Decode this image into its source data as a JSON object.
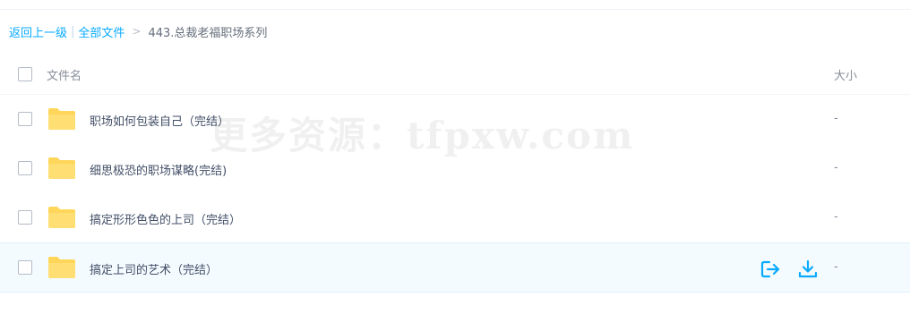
{
  "breadcrumb": {
    "back_label": "返回上一级",
    "separator": "|",
    "all_files_label": "全部文件",
    "arrow": ">",
    "current_folder": "443.总裁老福职场系列"
  },
  "table": {
    "columns": {
      "name": "文件名",
      "size": "大小"
    }
  },
  "files": [
    {
      "name": "职场如何包装自己（完结）",
      "size": "-",
      "type": "folder"
    },
    {
      "name": "细思极恐的职场谋略(完结)",
      "size": "-",
      "type": "folder"
    },
    {
      "name": "搞定形形色色的上司（完结）",
      "size": "-",
      "type": "folder"
    },
    {
      "name": "搞定上司的艺术（完结）",
      "size": "-",
      "type": "folder",
      "hovered": true
    }
  ],
  "row_actions": [
    {
      "icon": "share-icon"
    },
    {
      "icon": "download-icon"
    }
  ],
  "watermark": "更多资源：tfpxw.com",
  "colors": {
    "accent": "#09aaff",
    "folder": "#ffd659",
    "hover_row": "#f4fbff"
  }
}
